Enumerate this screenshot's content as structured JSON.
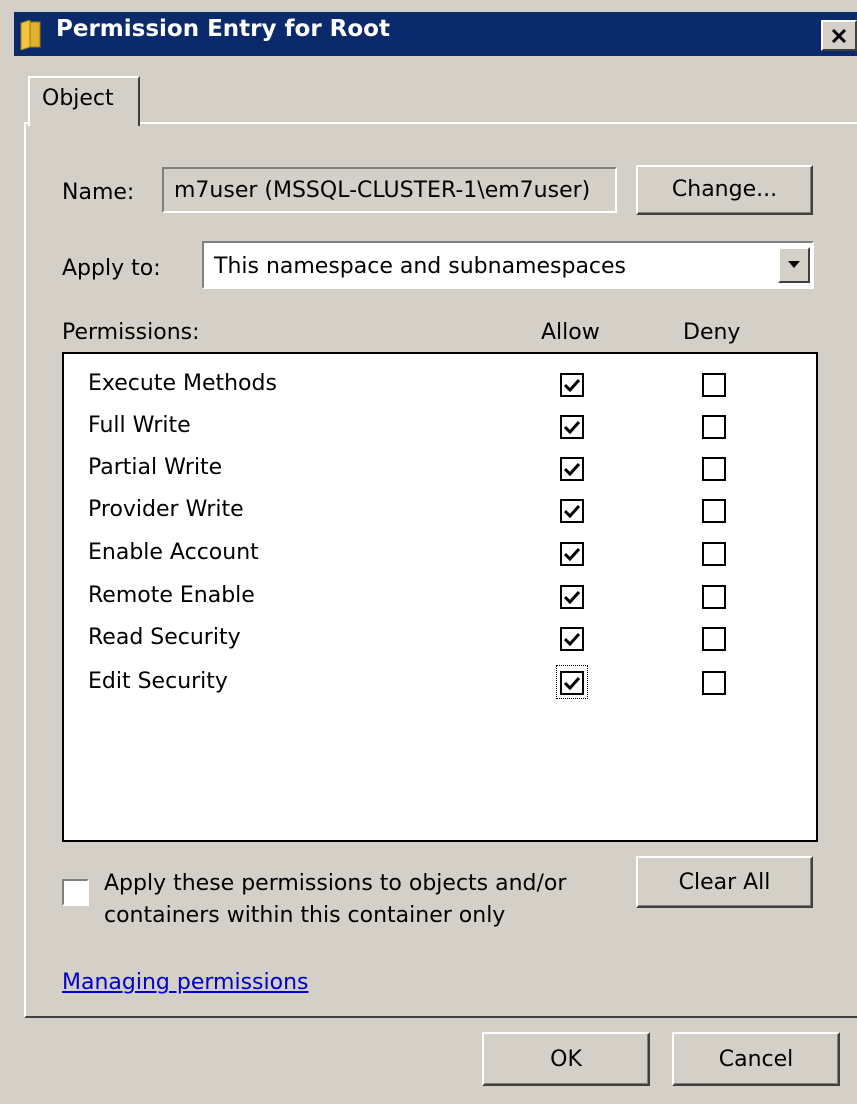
{
  "window": {
    "title": "Permission Entry for Root",
    "title_icon": "folder-icon",
    "close_icon": "close-icon",
    "titlebar_color": "#0b2a6b"
  },
  "tabs": [
    {
      "label": "Object",
      "selected": true
    }
  ],
  "name": {
    "label": "Name:",
    "value": "m7user (MSSQL-CLUSTER-1\\em7user)",
    "change_label": "Change..."
  },
  "apply_to": {
    "label": "Apply to:",
    "selected": "This namespace and subnamespaces"
  },
  "permissions": {
    "header_label": "Permissions:",
    "allow_header": "Allow",
    "deny_header": "Deny",
    "items": [
      {
        "name": "Execute Methods",
        "allow": true,
        "deny": false
      },
      {
        "name": "Full Write",
        "allow": true,
        "deny": false
      },
      {
        "name": "Partial Write",
        "allow": true,
        "deny": false
      },
      {
        "name": "Provider Write",
        "allow": true,
        "deny": false
      },
      {
        "name": "Enable Account",
        "allow": true,
        "deny": false
      },
      {
        "name": "Remote Enable",
        "allow": true,
        "deny": false
      },
      {
        "name": "Read Security",
        "allow": true,
        "deny": false
      },
      {
        "name": "Edit Security",
        "allow": true,
        "deny": false,
        "focused": true
      }
    ]
  },
  "apply_only": {
    "checked": false,
    "line1": "Apply these permissions to objects and/or",
    "line2": "containers within this container only"
  },
  "clear_all_label": "Clear All",
  "help_link": "Managing permissions",
  "footer": {
    "ok_label": "OK",
    "cancel_label": "Cancel"
  }
}
